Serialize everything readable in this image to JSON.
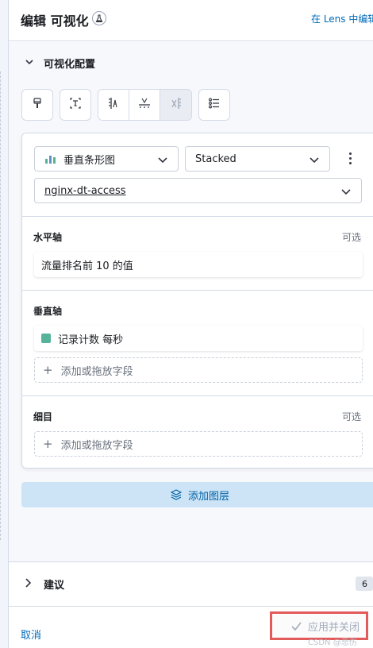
{
  "header": {
    "title": "编辑 可视化",
    "beta_icon": "flask-icon",
    "lens_link": "在 Lens 中编辑"
  },
  "config_section": {
    "label": "可视化配置",
    "expanded": true
  },
  "toolbar": {
    "buttons": [
      "paintbrush-icon",
      "text-box-icon",
      "left-axis-icon",
      "bottom-axis-icon",
      "right-axis-icon",
      "legend-list-icon"
    ]
  },
  "layer": {
    "chart_type": "垂直条形图",
    "chart_type_icon": "bar-chart-icon",
    "mode": "Stacked",
    "data_view": "nginx-dt-access",
    "horizontal_axis": {
      "title": "水平轴",
      "optional": "可选",
      "value": "流量排名前 10 的值"
    },
    "vertical_axis": {
      "title": "垂直轴",
      "value": "记录计数 每秒",
      "swatch_color": "#54b399",
      "add_label": "添加或拖放字段"
    },
    "breakdown": {
      "title": "细目",
      "optional": "可选",
      "add_label": "添加或拖放字段"
    }
  },
  "add_layer_label": "添加图层",
  "suggestions": {
    "label": "建议",
    "count": "6"
  },
  "footer": {
    "cancel": "取消",
    "apply": "应用并关闭"
  },
  "watermark": "CSDN @悲伤"
}
